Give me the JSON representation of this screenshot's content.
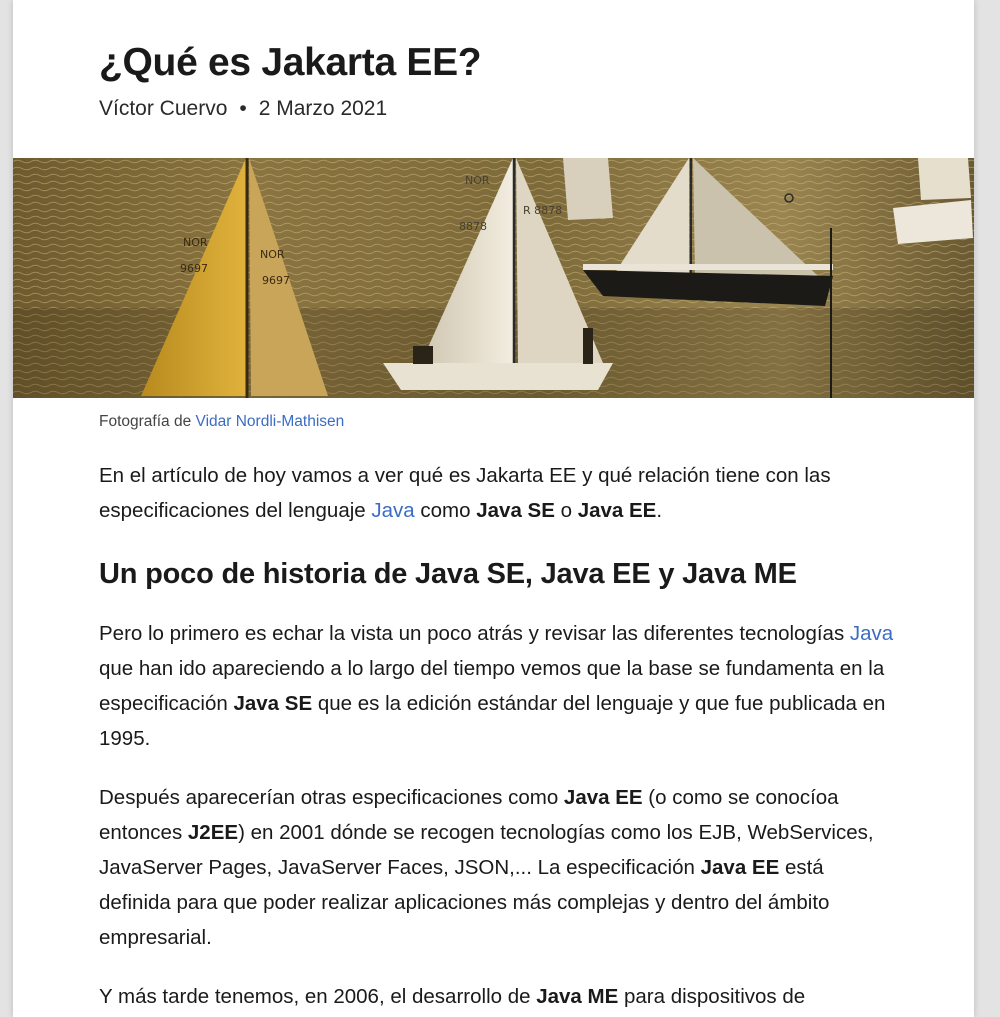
{
  "article": {
    "title": "¿Qué es Jakarta EE?",
    "author": "Víctor Cuervo",
    "separator": "•",
    "date": "2 Marzo 2021",
    "image_alt": "Veleros con velas numeradas NOR 9697 y NOR 8878 navegando al atardecer",
    "sail_numbers": [
      "NOR",
      "9697",
      "NOR",
      "8878"
    ],
    "caption_prefix": "Fotografía de",
    "caption_author": "Vidar Nordli-Mathisen"
  },
  "intro": {
    "t1": "En el artículo de hoy vamos a ver qué es Jakarta EE y qué relación tiene con las especificaciones del lenguaje ",
    "link": "Java",
    "t2": " como ",
    "b1": "Java SE",
    "t3": " o ",
    "b2": "Java EE",
    "t4": "."
  },
  "section_heading": "Un poco de historia de Java SE, Java EE y Java ME",
  "para1": {
    "t1": "Pero lo primero es echar la vista un poco atrás y revisar las diferentes tecnologías ",
    "link": "Java",
    "t2": " que han ido apareciendo a lo largo del tiempo vemos que la base se fundamenta en la especificación ",
    "b1": "Java SE",
    "t3": " que es la edición estándar del lenguaje y que fue publicada en 1995."
  },
  "para2": {
    "t1": "Después aparecerían otras especificaciones como ",
    "b1": "Java EE",
    "t2": " (o como se conocíoa entonces ",
    "b2": "J2EE",
    "t3": ") en 2001 dónde se recogen tecnologías como los EJB, WebServices, JavaServer Pages, JavaServer Faces, JSON,... La especificación ",
    "b3": "Java EE",
    "t4": " está definida para que poder realizar aplicaciones más complejas y dentro del ámbito empresarial."
  },
  "para3": {
    "t1": "Y más tarde tenemos, en 2006, el desarrollo de ",
    "b1": "Java ME",
    "t2": " para dispositivos de"
  },
  "colors": {
    "link": "#3b6cc4",
    "text": "#1a1a1a",
    "page_bg": "#ffffff",
    "outer_bg": "#e3e3e3"
  }
}
